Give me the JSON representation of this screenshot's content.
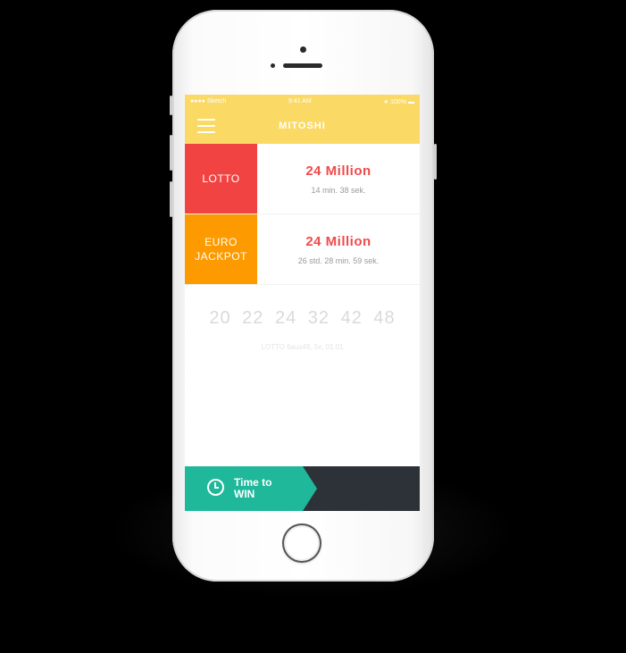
{
  "statusbar": {
    "carrier": "Sketch",
    "time": "9:41 AM",
    "battery": "100%"
  },
  "navbar": {
    "title": "MITOSHI",
    "menu_icon": "hamburger-icon"
  },
  "games": [
    {
      "label": "LOTTO",
      "amount": "24 Million",
      "countdown": "14 min. 38 sek.",
      "color": "#f24343"
    },
    {
      "label_line1": "EURO",
      "label_line2": "JACKPOT",
      "amount": "24 Million",
      "countdown": "26 std. 28 min. 59 sek.",
      "color": "#fd9a00"
    }
  ],
  "draw": {
    "numbers": [
      "20",
      "22",
      "24",
      "32",
      "42",
      "48"
    ],
    "caption": "LOTTO 6aus49, 5x, 01.01"
  },
  "bottom": {
    "line1": "Time to",
    "line2": "WIN",
    "icon": "clock-icon"
  },
  "colors": {
    "accent": "#fbd965",
    "lotto": "#f24343",
    "jackpot": "#fd9a00",
    "win": "#1fb89a",
    "bar": "#2c3238"
  }
}
